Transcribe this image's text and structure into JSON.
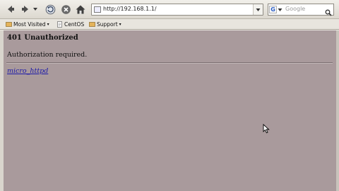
{
  "toolbar": {
    "url": "http://192.168.1.1/",
    "search_placeholder": "Google",
    "search_engine_letter": "G"
  },
  "bookmarks": [
    {
      "label": "Most Visited",
      "has_menu": true,
      "icon": "star-icon"
    },
    {
      "label": "CentOS",
      "has_menu": false,
      "icon": "page-icon"
    },
    {
      "label": "Support",
      "has_menu": true,
      "icon": "globe-icon"
    }
  ],
  "page": {
    "title": "401 Unauthorized",
    "message": "Authorization required.",
    "server_link": "micro_httpd"
  },
  "colors": {
    "page_background": "#a99a9c",
    "link": "#1d1aa8"
  }
}
